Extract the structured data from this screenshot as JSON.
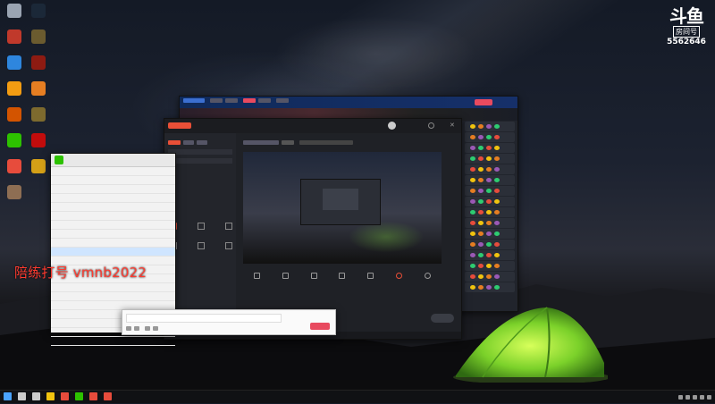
{
  "wallpaper": {
    "theme": "night-sky-tent"
  },
  "watermark": {
    "logo": "斗鱼",
    "room_label": "房间号",
    "room_number": "5562646"
  },
  "desktop_icons": [
    {
      "name": "recycle-bin-icon",
      "color": "#9aa4b2"
    },
    {
      "name": "steam-icon",
      "color": "#1b2838"
    },
    {
      "name": "app-icon",
      "color": "#c0392b"
    },
    {
      "name": "game-launcher-icon",
      "color": "#6b5b2f"
    },
    {
      "name": "browser-icon",
      "color": "#2e86de"
    },
    {
      "name": "dota2-icon",
      "color": "#8e1b12"
    },
    {
      "name": "app-icon",
      "color": "#f39c12"
    },
    {
      "name": "app-icon",
      "color": "#e67e22"
    },
    {
      "name": "app-icon",
      "color": "#d35400"
    },
    {
      "name": "game-launcher-icon",
      "color": "#7d6a2e"
    },
    {
      "name": "wechat-icon",
      "color": "#2dc100"
    },
    {
      "name": "netease-music-icon",
      "color": "#c20c0c"
    },
    {
      "name": "app-icon",
      "color": "#e74c3c"
    },
    {
      "name": "app-icon",
      "color": "#d4a017"
    },
    {
      "name": "app-icon",
      "color": "#8e6e53"
    }
  ],
  "promo_text": "陪练打号 vmnb2022",
  "windows": {
    "douyu_client": {
      "accent": "#1d3a6e",
      "live_button_color": "#e84a5f"
    },
    "stream_tool": {
      "accent": "#e94f37"
    },
    "room_list": {
      "title_icon_color": "#2dc100"
    },
    "chat_input": {}
  },
  "taskbar": {
    "icons": [
      "windows-start-icon",
      "search-icon",
      "task-view-icon",
      "file-explorer-icon",
      "app-icon",
      "wechat-icon",
      "app-icon",
      "app-icon"
    ],
    "tray_icons": [
      "cloud-icon",
      "chevron-up-icon",
      "network-icon",
      "volume-icon",
      "notification-icon"
    ]
  }
}
